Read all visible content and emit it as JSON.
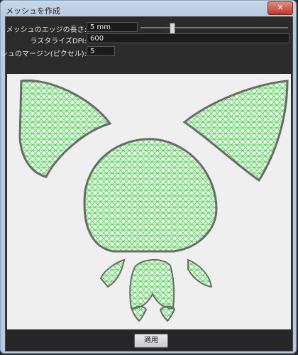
{
  "window": {
    "title": "メッシュを作成",
    "close_glyph": "✕"
  },
  "controls": {
    "edge_length": {
      "label": "メッシュのエッジの長さ:",
      "value": "5 mm",
      "slider_fraction": 0.2
    },
    "raster_dpi": {
      "label": "ラスタライズDPI:",
      "value": "600"
    },
    "margin": {
      "label": "メッシュのマージン(ピクセル):",
      "value": "5"
    }
  },
  "footer": {
    "apply_label": "適用"
  },
  "colors": {
    "mesh_line": "#33dd33",
    "outline": "#6a6a6a"
  },
  "icons": {
    "close": "close-icon"
  }
}
